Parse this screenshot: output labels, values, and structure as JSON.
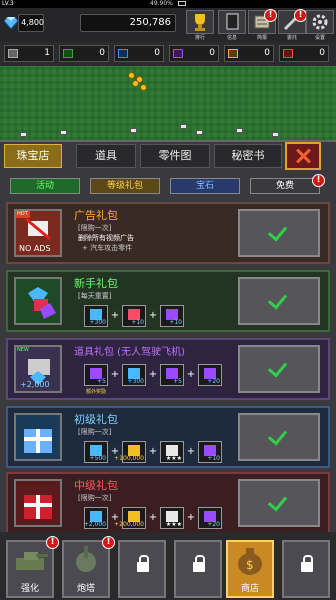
{
  "status": {
    "level": "LV.3",
    "battery": "49.90%"
  },
  "currency": {
    "gems": "4,800",
    "coins": "250,786"
  },
  "top_menu": [
    {
      "label": "排行"
    },
    {
      "label": "信息"
    },
    {
      "label": "简报"
    },
    {
      "label": "委托"
    },
    {
      "label": "设置"
    }
  ],
  "resources": [
    "1",
    "0",
    "0",
    "0",
    "0",
    "0"
  ],
  "tabs": [
    {
      "label": "珠宝店",
      "active": true
    },
    {
      "label": "道具"
    },
    {
      "label": "零件图"
    },
    {
      "label": "秘密书"
    }
  ],
  "filters": [
    {
      "label": "活动",
      "color": "#1e6a2a",
      "text_color": "#6aff6a"
    },
    {
      "label": "等级礼包",
      "color": "#5a4818",
      "text_color": "#ffd24a"
    },
    {
      "label": "宝石",
      "color": "#283a6a",
      "text_color": "#7fb8ff"
    },
    {
      "label": "免费",
      "color": "#3a3a3e",
      "text_color": "#ffffff"
    }
  ],
  "cards": [
    {
      "title": "广告礼包",
      "title_color": "#ffb020",
      "bg": "#3a2a26",
      "border": "#6a4a40",
      "thumb_label": "NO ADS",
      "thumb_badge": "HOT",
      "lines": [
        "[限购一次]",
        "删除所有视频广告",
        "+ 汽车攻击零件"
      ],
      "items": []
    },
    {
      "title": "新手礼包",
      "title_color": "#6aff6a",
      "bg": "#223522",
      "border": "#3a6a3a",
      "lines": [
        "[每天重置]"
      ],
      "items": [
        {
          "qty": "+300",
          "color": "#4ab8ff"
        },
        {
          "qty": "+10",
          "color": "#ff4a6a"
        },
        {
          "qty": "+10",
          "color": "#9a4aff"
        }
      ]
    },
    {
      "title": "道具礼包 (无人驾驶飞机)",
      "title_color": "#c070ff",
      "bg": "#2e2440",
      "border": "#5a4878",
      "thumb_badge": "NEW",
      "thumb_qty": "+2,000",
      "lines": [],
      "items": [
        {
          "qty": "+5",
          "color": "#9a4aff"
        },
        {
          "qty": "+300",
          "color": "#4ab8ff"
        },
        {
          "qty": "+5",
          "color": "#9a4aff"
        },
        {
          "qty": "+20",
          "color": "#9a4aff"
        }
      ],
      "note": "额外奖励"
    },
    {
      "title": "初级礼包",
      "title_color": "#7fd0ff",
      "bg": "#1e2a3e",
      "border": "#3a5a88",
      "lines": [
        "[限购一次]"
      ],
      "items": [
        {
          "qty": "+500",
          "color": "#4ab8ff"
        },
        {
          "qty": "+100,000",
          "color": "#f0c020"
        },
        {
          "qty": "★★★",
          "color": "#e8e8e8"
        },
        {
          "qty": "+10",
          "color": "#9a4aff"
        }
      ]
    },
    {
      "title": "中级礼包",
      "title_color": "#ff5a5a",
      "bg": "#3a1e22",
      "border": "#7a3a40",
      "lines": [
        "[限购一次]"
      ],
      "items": [
        {
          "qty": "+2,000",
          "color": "#4ab8ff"
        },
        {
          "qty": "+200,000",
          "color": "#f0c020"
        },
        {
          "qty": "★★★",
          "color": "#e8e8e8"
        },
        {
          "qty": "+20",
          "color": "#9a4aff"
        }
      ]
    }
  ],
  "bottom_nav": [
    {
      "label": "强化",
      "locked": false,
      "alert": true
    },
    {
      "label": "炮塔",
      "locked": false,
      "alert": true
    },
    {
      "label": "",
      "locked": true
    },
    {
      "label": "",
      "locked": true
    },
    {
      "label": "商店",
      "locked": false,
      "active": true
    },
    {
      "label": "",
      "locked": true
    }
  ]
}
